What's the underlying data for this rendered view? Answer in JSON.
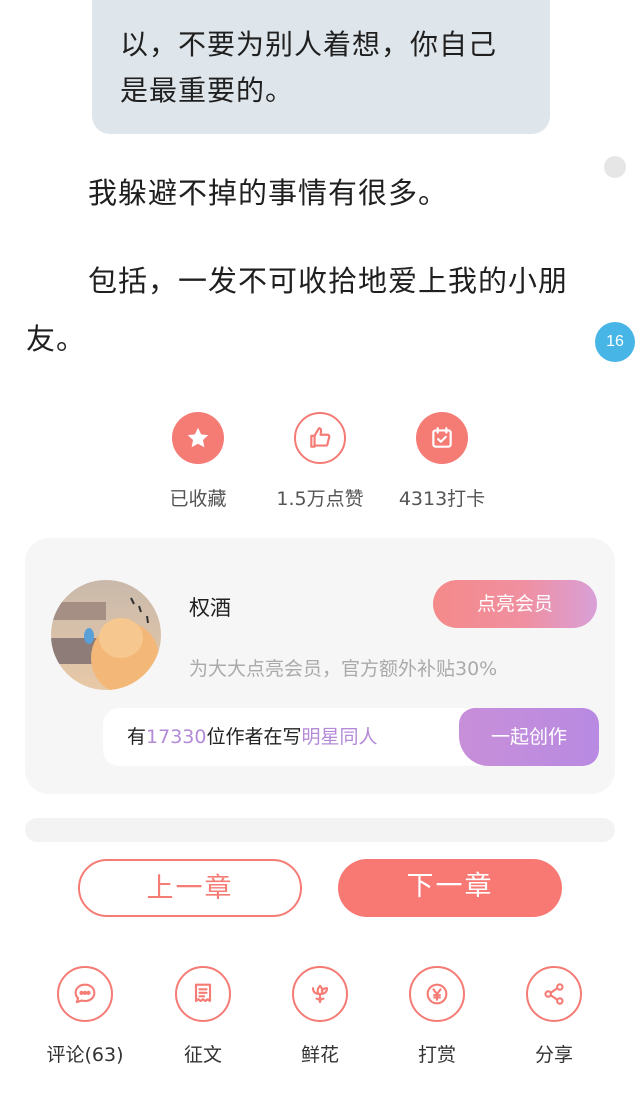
{
  "article": {
    "quote": "以，不要为别人着想，你自己是最重要的。",
    "paragraphs": [
      "我躲避不掉的事情有很多。",
      "包括，一发不可收拾地爱上我的小朋友。"
    ],
    "comment_count_badge": "16"
  },
  "actions": [
    {
      "label": "已收藏",
      "icon": "star-icon"
    },
    {
      "label": "1.5万点赞",
      "icon": "thumbs-up-icon"
    },
    {
      "label": "4313打卡",
      "icon": "calendar-check-icon"
    }
  ],
  "author_card": {
    "name": "权酒",
    "vip_button": "点亮会员",
    "vip_desc": "为大大点亮会员，官方额外补贴30%",
    "write_prefix": "有",
    "write_count": "17330",
    "write_middle": "位作者在写",
    "write_topic": "明星同人",
    "write_button": "一起创作"
  },
  "navigation": {
    "prev": "上一章",
    "next": "下一章"
  },
  "bottom_actions": [
    {
      "label": "评论(63)",
      "icon": "comment-icon"
    },
    {
      "label": "征文",
      "icon": "document-icon"
    },
    {
      "label": "鲜花",
      "icon": "flower-icon"
    },
    {
      "label": "打赏",
      "icon": "yen-icon"
    },
    {
      "label": "分享",
      "icon": "share-icon"
    }
  ],
  "colors": {
    "accent": "#f57b75",
    "purple": "#b88ae2",
    "badge_blue": "#47b5e6"
  }
}
